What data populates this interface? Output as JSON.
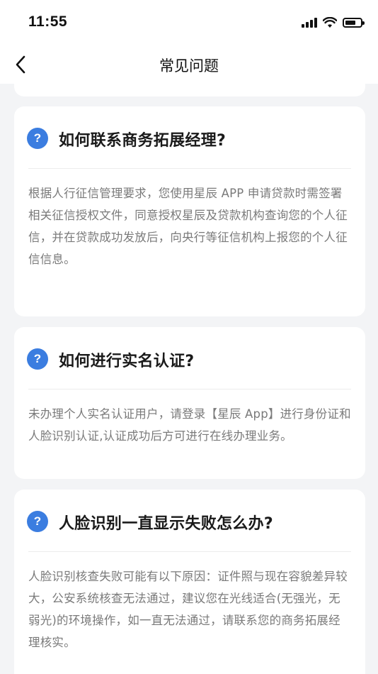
{
  "status_bar": {
    "time": "11:55"
  },
  "nav": {
    "title": "常见问题"
  },
  "faqs": [
    {
      "question": "如何联系商务拓展经理?",
      "answer": "根据人行征信管理要求，您使用星辰 APP 申请贷款时需签署相关征信授权文件，同意授权星辰及贷款机构查询您的个人征信，并在贷款成功发放后，向央行等征信机构上报您的个人征信信息。"
    },
    {
      "question": "如何进行实名认证?",
      "answer": "未办理个人实名认证用户，请登录【星辰 App】进行身份证和人脸识别认证,认证成功后方可进行在线办理业务。"
    },
    {
      "question": "人脸识别一直显示失败怎么办?",
      "answer": "人脸识别核查失败可能有以下原因：证件照与现在容貌差异较大，公安系统核查无法通过，建议您在光线适合(无强光，无弱光)的环境操作，如一直无法通过，请联系您的商务拓展经理核实。"
    }
  ],
  "colors": {
    "accent": "#3b7de0",
    "background": "#f3f4f6",
    "card": "#ffffff",
    "answer_text": "#7a7a7a"
  },
  "icons": {
    "back": "chevron-left-icon",
    "question": "question-mark-icon"
  }
}
